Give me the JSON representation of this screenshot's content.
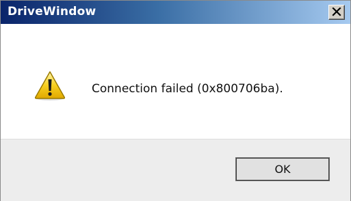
{
  "window": {
    "title": "DriveWindow"
  },
  "message": {
    "text": "Connection failed (0x800706ba).",
    "icon": "warning-icon"
  },
  "buttons": {
    "ok_label": "OK",
    "close_icon": "close-icon"
  },
  "colors": {
    "title_gradient_start": "#0a246a",
    "title_gradient_end": "#a6caf0",
    "warning_yellow": "#f5c400",
    "footer_bg": "#ededed"
  }
}
